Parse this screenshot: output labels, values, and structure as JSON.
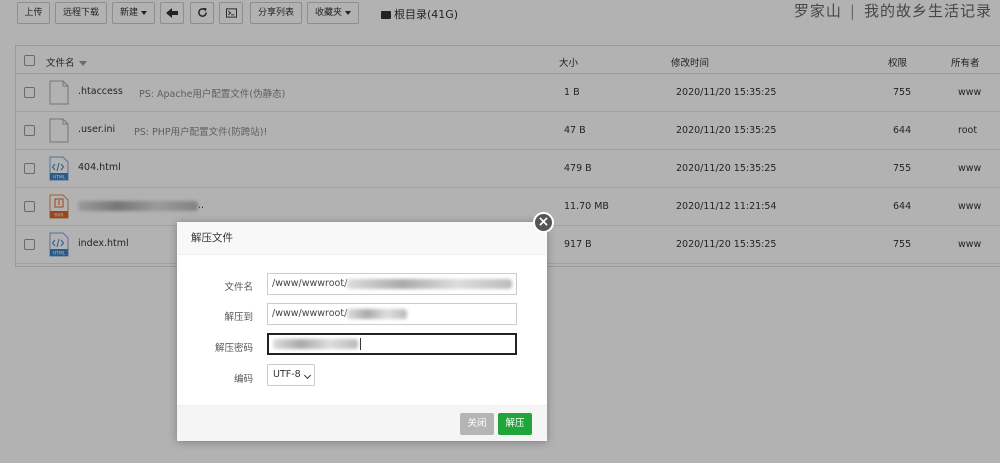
{
  "toolbar": {
    "upload": "上传",
    "remote_download": "远程下载",
    "new": "新建",
    "share_list": "分享列表",
    "favorites": "收藏夹",
    "root_dir": "根目录(41G)"
  },
  "site": {
    "name": "罗家山",
    "separator": "|",
    "tagline": "我的故乡生活记录"
  },
  "table": {
    "headers": {
      "name": "文件名",
      "size": "大小",
      "mtime": "修改时间",
      "perm": "权限",
      "owner": "所有者"
    },
    "rows": [
      {
        "name": ".htaccess",
        "ps": "PS: Apache用户配置文件(伪静态)",
        "size": "1 B",
        "mtime": "2020/11/20 15:35:25",
        "perm": "755",
        "owner": "www",
        "icon": "file-icon"
      },
      {
        "name": ".user.ini",
        "ps": "PS: PHP用户配置文件(防跨站)!",
        "size": "47 B",
        "mtime": "2020/11/20 15:35:25",
        "perm": "644",
        "owner": "root",
        "icon": "file-icon"
      },
      {
        "name": "404.html",
        "ps": "",
        "size": "479 B",
        "mtime": "2020/11/20 15:35:25",
        "perm": "755",
        "owner": "www",
        "icon": "html-file-icon"
      },
      {
        "name": "..",
        "ps": "",
        "size": "11.70 MB",
        "mtime": "2020/11/12 11:21:54",
        "perm": "644",
        "owner": "www",
        "icon": "rar-file-icon"
      },
      {
        "name": "index.html",
        "ps": "",
        "size": "917 B",
        "mtime": "2020/11/20 15:35:25",
        "perm": "755",
        "owner": "www",
        "icon": "html-file-icon"
      }
    ]
  },
  "dialog": {
    "title": "解压文件",
    "close_symbol": "×",
    "filename_label": "文件名",
    "filename_value": "/www/wwwroot/",
    "extract_to_label": "解压到",
    "extract_to_value": "/www/wwwroot/",
    "password_label": "解压密码",
    "encoding_label": "编码",
    "encoding_value": "UTF-8",
    "cancel_label": "关闭",
    "confirm_label": "解压"
  },
  "colors": {
    "primary": "#20a53a",
    "disabled": "#b5b5b5",
    "overlay": "rgba(0,0,0,0.3)"
  },
  "icon_labels": {
    "html": "HTML",
    "rar": "RAR"
  }
}
